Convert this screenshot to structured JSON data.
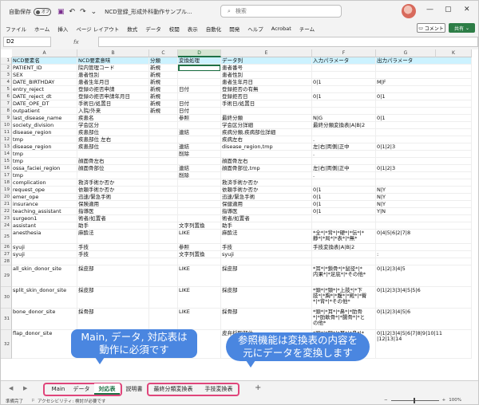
{
  "titlebar": {
    "autosave_label": "自動保存",
    "autosave_state": "オフ",
    "doc_title": "NCD登録_形成外科動作サンプル...",
    "search_placeholder": "検索"
  },
  "ribbon_tabs": [
    "ファイル",
    "ホーム",
    "挿入",
    "ページ レイアウト",
    "数式",
    "データ",
    "校閲",
    "表示",
    "自動化",
    "開発",
    "ヘルプ",
    "Acrobat",
    "チーム"
  ],
  "ribbon_buttons": {
    "comment": "コメント",
    "share": "共有"
  },
  "formula": {
    "namebox": "D2",
    "fx": "fx"
  },
  "columns": [
    "A",
    "B",
    "C",
    "D",
    "E",
    "F",
    "G",
    "K"
  ],
  "rows": [
    {
      "n": "1",
      "h": 9,
      "c": [
        "NCD要素名",
        "NCD要素意味",
        "分類",
        "変換処理",
        "データ列",
        "入力パラメータ",
        "出力パラメータ"
      ]
    },
    {
      "n": "2",
      "h": 9,
      "c": [
        "PATIENT_ID",
        "院内管理コード",
        "新規",
        "",
        "患者番号",
        "",
        ""
      ]
    },
    {
      "n": "3",
      "h": 9,
      "c": [
        "SEX",
        "患者性別",
        "新規",
        "",
        "患者性別",
        "",
        ""
      ]
    },
    {
      "n": "4",
      "h": 9,
      "c": [
        "DATE_BIRTHDAY",
        "患者生年月日",
        "新規",
        "",
        "患者生年月日",
        "0|1",
        "M|F"
      ]
    },
    {
      "n": "5",
      "h": 9,
      "c": [
        "entry_reject",
        "登録の拒否申請",
        "新規",
        "日付",
        "登録拒否の有無",
        "",
        ""
      ]
    },
    {
      "n": "6",
      "h": 9,
      "c": [
        "DATE_reject_dt",
        "登録の拒否申請年月日",
        "新規",
        "",
        "登録拒否日",
        "0|1",
        "0|1"
      ]
    },
    {
      "n": "7",
      "h": 9,
      "c": [
        "DATE_OPE_DT",
        "手術日/処置日",
        "新規",
        "日付",
        "手術日/処置日",
        "",
        ""
      ]
    },
    {
      "n": "8",
      "h": 9,
      "c": [
        "outpatient",
        "入院/外来",
        "新規",
        "日付",
        "",
        "",
        ""
      ]
    },
    {
      "n": "9",
      "h": 9,
      "c": [
        "last_disease_name",
        "疾患名",
        "",
        "参照",
        "最終分類",
        "N|G",
        "0|1"
      ]
    },
    {
      "n": "10",
      "h": 9,
      "c": [
        "society_division",
        "学会区分",
        "",
        "",
        "学会区分詳細",
        "最終分類変換表|A|B|2",
        ""
      ]
    },
    {
      "n": "11",
      "h": 9,
      "c": [
        "disease_region",
        "疾患部位",
        "",
        "連結",
        "疾病分類,疾病部位詳細",
        "",
        ""
      ]
    },
    {
      "n": "12",
      "h": 9,
      "c": [
        "tmp",
        "疾患部位 左右",
        "",
        "",
        "疾病左右",
        ".",
        ""
      ]
    },
    {
      "n": "13",
      "h": 9,
      "c": [
        "disease_region",
        "疾患部位",
        "",
        "連結",
        "disease_region,tmp",
        "左|右|両側|正中",
        "0|1|2|3"
      ]
    },
    {
      "n": "14",
      "h": 9,
      "c": [
        "tmp",
        "",
        "",
        "削除",
        "",
        ".",
        ""
      ]
    },
    {
      "n": "15",
      "h": 9,
      "c": [
        "tmp",
        "顔面骨左右",
        "",
        "",
        "顔面骨左右",
        "",
        ""
      ]
    },
    {
      "n": "16",
      "h": 9,
      "c": [
        "ossa_faciei_region",
        "顔面骨部位",
        "",
        "連結",
        "顔面骨部位,tmp",
        "左|右|両側|正中",
        "0|1|2|3"
      ]
    },
    {
      "n": "17",
      "h": 9,
      "c": [
        "tmp",
        "",
        "",
        "削除",
        "",
        ".",
        ""
      ]
    },
    {
      "n": "18",
      "h": 9,
      "c": [
        "complication",
        "救済手術か否か",
        "",
        "",
        "救済手術か否か",
        "",
        ""
      ]
    },
    {
      "n": "19",
      "h": 9,
      "c": [
        "request_ope",
        "依頼手術か否か",
        "",
        "",
        "依頼手術か否か",
        "0|1",
        "N|Y"
      ]
    },
    {
      "n": "20",
      "h": 9,
      "c": [
        "emer_ope",
        "迅速/緊急手術",
        "",
        "",
        "迅速/緊急手術",
        "0|1",
        "N|Y"
      ]
    },
    {
      "n": "21",
      "h": 9,
      "c": [
        "insurance",
        "保険適用",
        "",
        "",
        "保健適用",
        "0|1",
        "N|Y"
      ]
    },
    {
      "n": "22",
      "h": 9,
      "c": [
        "teaching_assistant",
        "指導医",
        "",
        "",
        "指導医",
        "0|1",
        "Y|N"
      ]
    },
    {
      "n": "23",
      "h": 9,
      "c": [
        "surgeon1",
        "術者/処置者",
        "",
        "",
        "術者/処置者",
        "",
        ""
      ]
    },
    {
      "n": "24",
      "h": 9,
      "c": [
        "assistant",
        "助手",
        "",
        "文字列置換",
        "助手",
        "",
        ""
      ]
    },
    {
      "n": "25",
      "h": 18,
      "c": [
        "anesthesia",
        "麻酔法",
        "",
        "LIKE",
        "麻酔法",
        "*全*|*背*|*硬*|*伝*|*\n静*|*局*|*表*|*無*",
        "0|4|5|6|2|7|8"
      ]
    },
    {
      "n": "26",
      "h": 9,
      "c": [
        "syuji",
        "手技",
        "",
        "参照",
        "手技",
        "手技変換表|A|B|2",
        ""
      ]
    },
    {
      "n": "27",
      "h": 9,
      "c": [
        "syuji",
        "手技",
        "",
        "文字列置換",
        "syuji",
        "",
        ":"
      ]
    },
    {
      "n": "28",
      "h": 9,
      "c": [
        "",
        "",
        "",
        "",
        "",
        "",
        ""
      ]
    },
    {
      "n": "29",
      "h": 27,
      "c": [
        "all_skin_donor_site",
        "採皮部",
        "",
        "LIKE",
        "採皮部",
        "*耳*|*鎖骨*|*鼠径*|*\n内果*|*足底*|*その他*",
        "0|1|2|3|4|5"
      ]
    },
    {
      "n": "30",
      "h": 27,
      "c": [
        "split_skin_donor_site",
        "採皮部",
        "",
        "LIKE",
        "採皮部",
        "*頭*|*頸*|*上肢*|*下\n肢*|*胸*|*腹*|*殿*|*臀\n*|*背*|*その他*",
        "0|1|2|3|3|4|5|5|6"
      ]
    },
    {
      "n": "31",
      "h": 27,
      "c": [
        "bone_donor_site",
        "採骨部",
        "",
        "LIKE",
        "採骨部",
        "*頭*|*耳*|*鼻*|*肋骨\n*|*肋軟骨*|*腸骨*|*と\nの他*",
        "0|1|2|3|4|5|6"
      ]
    },
    {
      "n": "32",
      "h": 36,
      "c": [
        "flap_donor_site",
        "皮弁採取部位",
        "",
        "LIKE",
        "皮弁採取部位",
        "*頭*|*頸*|*耳*|*鼻*|*\n臉*|*口唇*|*鼻の\n*|*胸*|*上肢*|*手*|*\n臓*|*その他*",
        "0|1|2|3|4|5|6|7|8|9|10|11\n|12|13|14"
      ]
    }
  ],
  "callouts": {
    "left": [
      "Main, データ, 対応表は",
      "動作に必須です"
    ],
    "right": [
      "参照機能は変換表の内容を",
      "元にデータを変換します"
    ]
  },
  "sheet_tabs": [
    "Main",
    "データ",
    "対応表",
    "説明書",
    "最終分類変換表",
    "手技変換表"
  ],
  "active_sheet": "対応表",
  "status": {
    "ready": "準備完了",
    "accessibility": "アクセシビリティ: 検討が必要です",
    "zoom": "100%"
  },
  "colors": {
    "accent": "#1e7145",
    "header_band": "#ccf2ff",
    "callout": "#4a86e0",
    "tab_group": "#e0457b"
  }
}
